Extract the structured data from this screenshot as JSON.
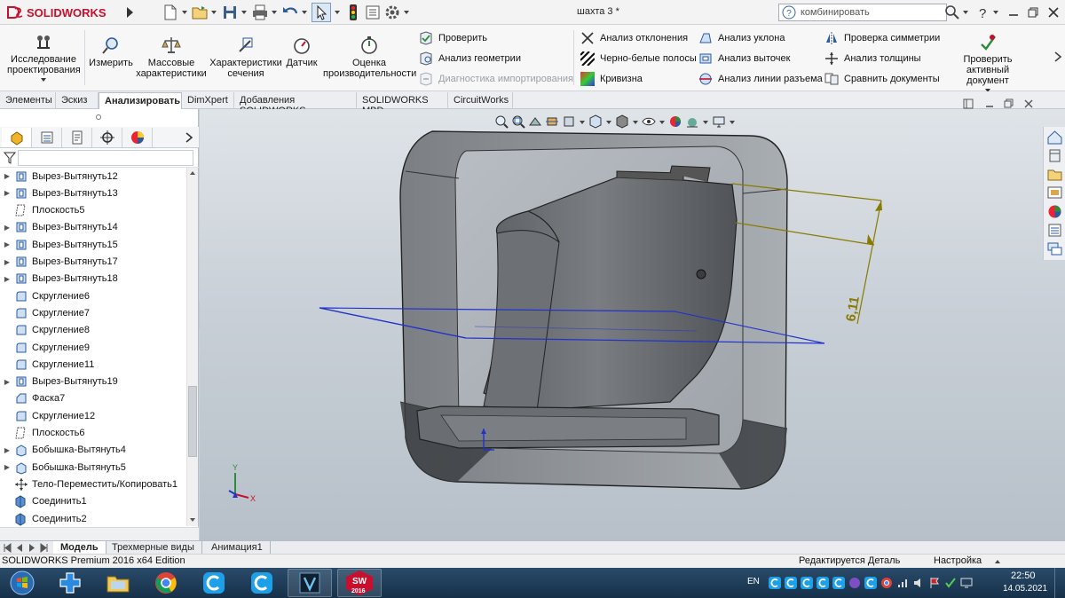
{
  "app": {
    "brand": "SOLIDWORKS",
    "doc_title": "шахта 3 *"
  },
  "search": {
    "value": "комбинировать"
  },
  "ribbon": {
    "big_buttons": [
      {
        "label": "Исследование\nпроектирования",
        "icon": "design-study-icon"
      },
      {
        "label": "Измерить",
        "icon": "measure-icon"
      },
      {
        "label": "Массовые\nхарактеристики",
        "icon": "mass-properties-icon"
      },
      {
        "label": "Характеристики\nсечения",
        "icon": "section-properties-icon"
      },
      {
        "label": "Датчик",
        "icon": "sensor-icon"
      },
      {
        "label": "Оценка\nпроизводительности",
        "icon": "performance-icon"
      }
    ],
    "col1": [
      "Проверить",
      "Анализ геометрии",
      "Диагностика импортирования"
    ],
    "col2": [
      "Анализ отклонения",
      "Черно-белые полосы",
      "Кривизна"
    ],
    "col3": [
      "Анализ уклона",
      "Анализ выточек",
      "Анализ линии разъема"
    ],
    "col4": [
      "Проверка симметрии",
      "Анализ толщины",
      "Сравнить документы"
    ],
    "check_active": "Проверить\nактивный документ"
  },
  "tabs": [
    "Элементы",
    "Эскиз",
    "Анализировать",
    "DimXpert",
    "Добавления SOLIDWORKS",
    "SOLIDWORKS MBD",
    "CircuitWorks"
  ],
  "active_tab": "Анализировать",
  "tree": [
    {
      "label": "Вырез-Вытянуть12",
      "icon": "cut-extrude-icon",
      "expandable": true
    },
    {
      "label": "Вырез-Вытянуть13",
      "icon": "cut-extrude-icon",
      "expandable": true
    },
    {
      "label": "Плоскость5",
      "icon": "plane-icon",
      "expandable": false
    },
    {
      "label": "Вырез-Вытянуть14",
      "icon": "cut-extrude-icon",
      "expandable": true
    },
    {
      "label": "Вырез-Вытянуть15",
      "icon": "cut-extrude-icon",
      "expandable": true
    },
    {
      "label": "Вырез-Вытянуть17",
      "icon": "cut-extrude-icon",
      "expandable": true
    },
    {
      "label": "Вырез-Вытянуть18",
      "icon": "cut-extrude-icon",
      "expandable": true
    },
    {
      "label": "Скругление6",
      "icon": "fillet-icon",
      "expandable": false
    },
    {
      "label": "Скругление7",
      "icon": "fillet-icon",
      "expandable": false
    },
    {
      "label": "Скругление8",
      "icon": "fillet-icon",
      "expandable": false
    },
    {
      "label": "Скругление9",
      "icon": "fillet-icon",
      "expandable": false
    },
    {
      "label": "Скругление11",
      "icon": "fillet-icon",
      "expandable": false
    },
    {
      "label": "Вырез-Вытянуть19",
      "icon": "cut-extrude-icon",
      "expandable": true
    },
    {
      "label": "Фаска7",
      "icon": "chamfer-icon",
      "expandable": false
    },
    {
      "label": "Скругление12",
      "icon": "fillet-icon",
      "expandable": false
    },
    {
      "label": "Плоскость6",
      "icon": "plane-icon",
      "expandable": false
    },
    {
      "label": "Бобышка-Вытянуть4",
      "icon": "boss-extrude-icon",
      "expandable": true
    },
    {
      "label": "Бобышка-Вытянуть5",
      "icon": "boss-extrude-icon",
      "expandable": true
    },
    {
      "label": "Тело-Переместить/Копировать1",
      "icon": "move-copy-body-icon",
      "expandable": false
    },
    {
      "label": "Соединить1",
      "icon": "combine-icon",
      "expandable": false
    },
    {
      "label": "Соединить2",
      "icon": "combine-icon",
      "expandable": false
    }
  ],
  "dimension": "6,11",
  "triad": {
    "x": "X",
    "y": "Y"
  },
  "bottom_tabs": [
    "Модель",
    "Трехмерные виды",
    "Анимация1"
  ],
  "active_bottom_tab": "Модель",
  "status": {
    "edition": "SOLIDWORKS Premium 2016 x64 Edition",
    "editing": "Редактируется Деталь",
    "units": "Настройка"
  },
  "taskbar": {
    "lang": "EN",
    "time": "22:50",
    "date": "14.05.2021",
    "sw_badge": "2016"
  },
  "colors": {
    "accent_red": "#c8102e",
    "dimension": "#8a7a00",
    "plane": "#2233cc"
  }
}
